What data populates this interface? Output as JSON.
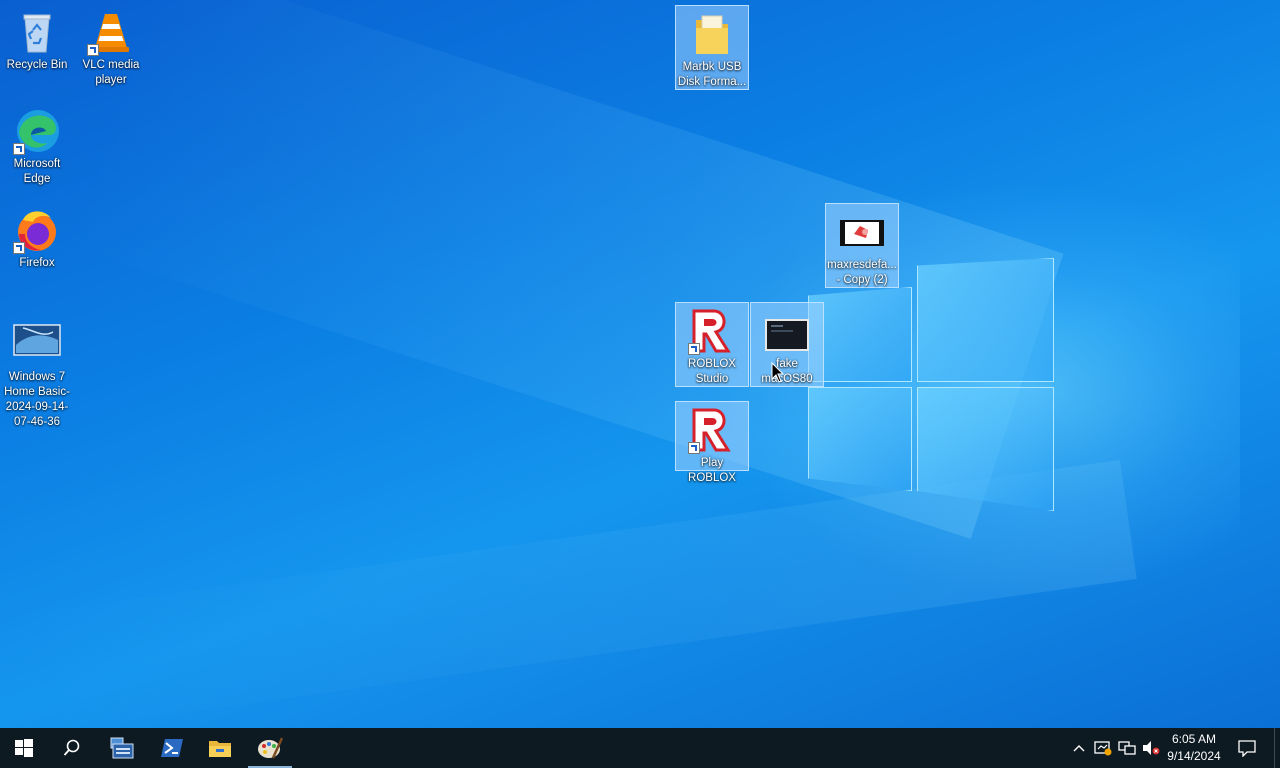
{
  "desktop": {
    "icons": [
      {
        "label": "Recycle Bin",
        "icon": "recycle-bin-icon"
      },
      {
        "label": "VLC media player",
        "icon": "vlc-icon"
      },
      {
        "label": "Microsoft Edge",
        "icon": "edge-icon"
      },
      {
        "label": "Firefox",
        "icon": "firefox-icon"
      },
      {
        "label": "Windows 7 Home Basic-2024-09-14-07-46-36",
        "icon": "screenshot-thumbnail-icon"
      },
      {
        "label": "Marbk USB Disk Forma...",
        "icon": "folder-icon"
      },
      {
        "label": "maxresdefa... - Copy (2)",
        "icon": "image-thumbnail-icon"
      },
      {
        "label": "ROBLOX Studio",
        "icon": "roblox-icon"
      },
      {
        "label": "fake macOS80",
        "icon": "dark-window-thumbnail-icon"
      },
      {
        "label": "Play ROBLOX",
        "icon": "roblox-icon"
      }
    ]
  },
  "taskbar": {
    "start_icon": "windows-start-icon",
    "search_icon": "search-icon",
    "pinned": [
      {
        "name": "server-manager",
        "icon": "server-manager-icon"
      },
      {
        "name": "powershell",
        "icon": "powershell-icon"
      },
      {
        "name": "file-explorer",
        "icon": "file-explorer-icon"
      },
      {
        "name": "paint",
        "icon": "paint-icon"
      }
    ],
    "tray": {
      "time": "6:05 AM",
      "date": "9/14/2024"
    }
  },
  "colors": {
    "taskbar_bg": "#0e1a22",
    "accent": "#0b7ee3"
  }
}
